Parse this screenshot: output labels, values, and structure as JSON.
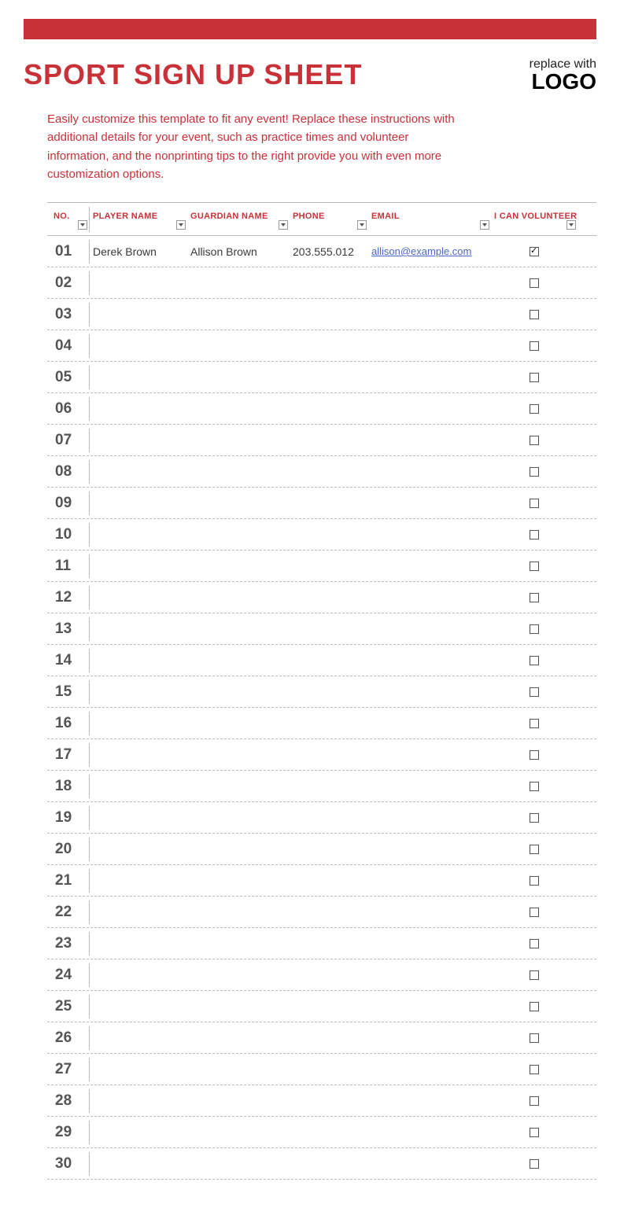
{
  "title": "SPORT SIGN UP SHEET",
  "logo": {
    "small": "replace with",
    "big": "LOGO"
  },
  "instructions": "Easily customize this template to fit any event! Replace these instructions with additional details for your event, such as practice times and volunteer information, and the nonprinting tips to the right provide you with even more customization options.",
  "columns": {
    "no": "NO.",
    "player": "PLAYER NAME",
    "guardian": "GUARDIAN NAME",
    "phone": "PHONE",
    "email": "EMAIL",
    "volunteer": "I CAN VOLUNTEER"
  },
  "rows": [
    {
      "no": "01",
      "player": "Derek Brown",
      "guardian": "Allison Brown",
      "phone": "203.555.012",
      "email": "allison@example.com",
      "volunteer": true
    },
    {
      "no": "02",
      "player": "",
      "guardian": "",
      "phone": "",
      "email": "",
      "volunteer": false
    },
    {
      "no": "03",
      "player": "",
      "guardian": "",
      "phone": "",
      "email": "",
      "volunteer": false
    },
    {
      "no": "04",
      "player": "",
      "guardian": "",
      "phone": "",
      "email": "",
      "volunteer": false
    },
    {
      "no": "05",
      "player": "",
      "guardian": "",
      "phone": "",
      "email": "",
      "volunteer": false
    },
    {
      "no": "06",
      "player": "",
      "guardian": "",
      "phone": "",
      "email": "",
      "volunteer": false
    },
    {
      "no": "07",
      "player": "",
      "guardian": "",
      "phone": "",
      "email": "",
      "volunteer": false
    },
    {
      "no": "08",
      "player": "",
      "guardian": "",
      "phone": "",
      "email": "",
      "volunteer": false
    },
    {
      "no": "09",
      "player": "",
      "guardian": "",
      "phone": "",
      "email": "",
      "volunteer": false
    },
    {
      "no": "10",
      "player": "",
      "guardian": "",
      "phone": "",
      "email": "",
      "volunteer": false
    },
    {
      "no": "11",
      "player": "",
      "guardian": "",
      "phone": "",
      "email": "",
      "volunteer": false
    },
    {
      "no": "12",
      "player": "",
      "guardian": "",
      "phone": "",
      "email": "",
      "volunteer": false
    },
    {
      "no": "13",
      "player": "",
      "guardian": "",
      "phone": "",
      "email": "",
      "volunteer": false
    },
    {
      "no": "14",
      "player": "",
      "guardian": "",
      "phone": "",
      "email": "",
      "volunteer": false
    },
    {
      "no": "15",
      "player": "",
      "guardian": "",
      "phone": "",
      "email": "",
      "volunteer": false
    },
    {
      "no": "16",
      "player": "",
      "guardian": "",
      "phone": "",
      "email": "",
      "volunteer": false
    },
    {
      "no": "17",
      "player": "",
      "guardian": "",
      "phone": "",
      "email": "",
      "volunteer": false
    },
    {
      "no": "18",
      "player": "",
      "guardian": "",
      "phone": "",
      "email": "",
      "volunteer": false
    },
    {
      "no": "19",
      "player": "",
      "guardian": "",
      "phone": "",
      "email": "",
      "volunteer": false
    },
    {
      "no": "20",
      "player": "",
      "guardian": "",
      "phone": "",
      "email": "",
      "volunteer": false
    },
    {
      "no": "21",
      "player": "",
      "guardian": "",
      "phone": "",
      "email": "",
      "volunteer": false
    },
    {
      "no": "22",
      "player": "",
      "guardian": "",
      "phone": "",
      "email": "",
      "volunteer": false
    },
    {
      "no": "23",
      "player": "",
      "guardian": "",
      "phone": "",
      "email": "",
      "volunteer": false
    },
    {
      "no": "24",
      "player": "",
      "guardian": "",
      "phone": "",
      "email": "",
      "volunteer": false
    },
    {
      "no": "25",
      "player": "",
      "guardian": "",
      "phone": "",
      "email": "",
      "volunteer": false
    },
    {
      "no": "26",
      "player": "",
      "guardian": "",
      "phone": "",
      "email": "",
      "volunteer": false
    },
    {
      "no": "27",
      "player": "",
      "guardian": "",
      "phone": "",
      "email": "",
      "volunteer": false
    },
    {
      "no": "28",
      "player": "",
      "guardian": "",
      "phone": "",
      "email": "",
      "volunteer": false
    },
    {
      "no": "29",
      "player": "",
      "guardian": "",
      "phone": "",
      "email": "",
      "volunteer": false
    },
    {
      "no": "30",
      "player": "",
      "guardian": "",
      "phone": "",
      "email": "",
      "volunteer": false
    }
  ]
}
